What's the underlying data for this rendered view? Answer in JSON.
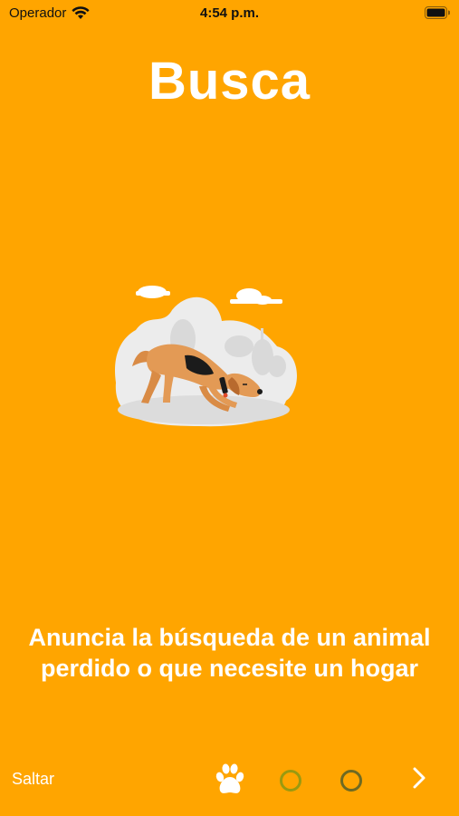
{
  "status_bar": {
    "carrier": "Operador",
    "time": "4:54 p.m."
  },
  "onboarding": {
    "title": "Busca",
    "description": "Anuncia la búsqueda de un animal perdido o que necesite un hogar",
    "illustration_subject": "dog-sniffing-illustration"
  },
  "footer": {
    "skip_label": "Saltar",
    "pages_total": 3,
    "current_page": 1,
    "colors": {
      "background": "#FFA500",
      "dot_inactive_1": "#9A9A10",
      "dot_inactive_2": "#6E6A22"
    }
  }
}
